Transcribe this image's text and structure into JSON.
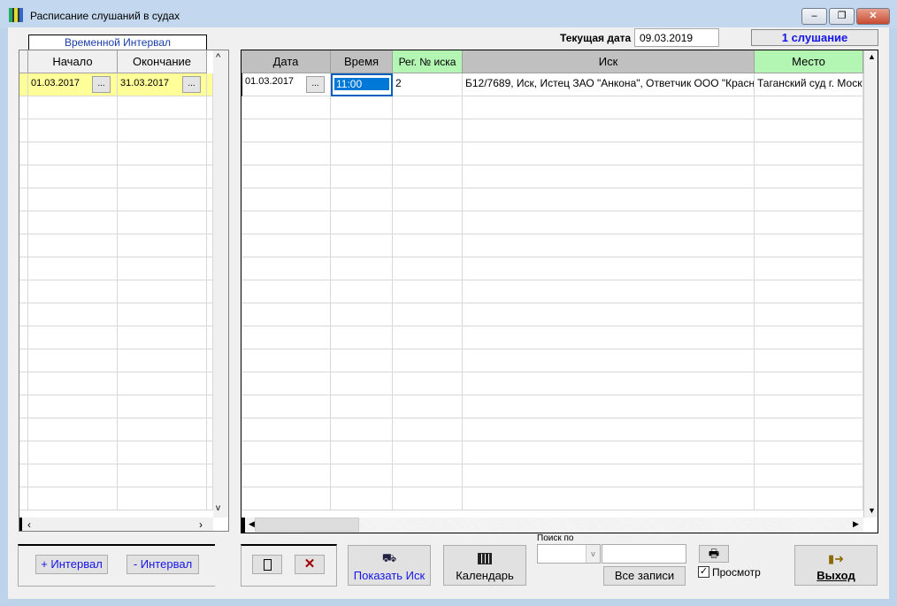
{
  "window": {
    "title": "Расписание слушаний в судах",
    "minimize": "–",
    "restore": "❐",
    "close": "✕"
  },
  "current_date": {
    "label": "Текущая дата",
    "value": "09.03.2019"
  },
  "hearings_count": "1 слушание",
  "interval": {
    "tab_label": "Временной Интервал",
    "columns": [
      "Начало",
      "Окончание"
    ],
    "rows": [
      [
        "01.03.2017",
        "31.03.2017"
      ]
    ],
    "add": "+ Интервал",
    "remove": "- Интервал"
  },
  "main_grid": {
    "columns": [
      "Дата",
      "Время",
      "Рег. № иска",
      "Иск",
      "Место"
    ],
    "rows": [
      [
        "01.03.2017",
        "11:00",
        "2",
        "Б12/7689, Иск, Истец ЗАО \"Анкона\", Ответчик ООО \"Красн",
        "Таганский суд г. Москвы"
      ]
    ]
  },
  "dots": "...",
  "toolbar": {
    "show_claim": "Показать Иск",
    "calendar": "Календарь",
    "search_label": "Поиск по",
    "search_value": "",
    "all_records": "Все записи",
    "preview": "Просмотр",
    "exit": "Выход"
  },
  "colors": {
    "row_highlight": "#ffff99",
    "header_green": "#b3f5b3",
    "header_gray": "#c0c0c0",
    "accent_blue": "#0000ff"
  }
}
